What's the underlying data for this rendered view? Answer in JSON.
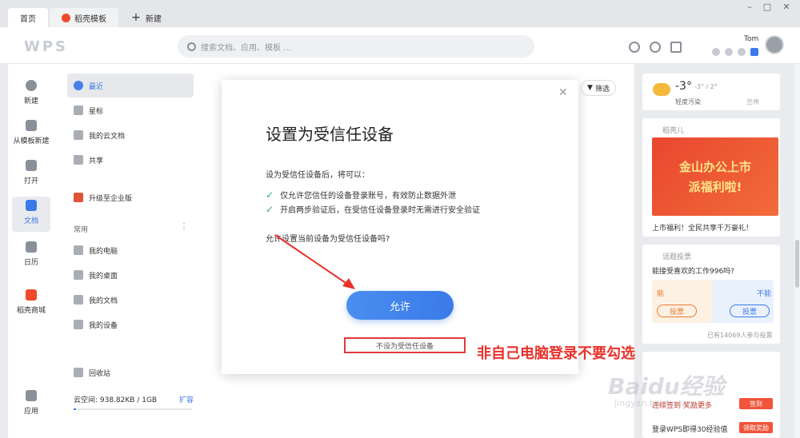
{
  "tabs": {
    "home": "首页",
    "template": "稻壳模板",
    "new": "新建"
  },
  "toolbar": {
    "logo": "WPS",
    "search_placeholder": "搜索文档、应用、模板 ...",
    "user": "Tom"
  },
  "leftnav": {
    "items": [
      {
        "label": "新建",
        "icon": "plus-circle-icon"
      },
      {
        "label": "从模板新建",
        "icon": "template-icon"
      },
      {
        "label": "打开",
        "icon": "folder-icon"
      },
      {
        "label": "文档",
        "icon": "document-icon"
      },
      {
        "label": "日历",
        "icon": "calendar-icon"
      },
      {
        "label": "稻壳商城",
        "icon": "shop-icon"
      },
      {
        "label": "应用",
        "icon": "apps-icon"
      }
    ]
  },
  "sidebar": {
    "items": [
      {
        "label": "最近",
        "icon": "clock-icon"
      },
      {
        "label": "星标",
        "icon": "star-icon"
      },
      {
        "label": "我的云文档",
        "icon": "cloud-icon"
      },
      {
        "label": "共享",
        "icon": "share-icon"
      },
      {
        "label": "升级至企业版",
        "icon": "enterprise-icon"
      }
    ],
    "common_title": "常用",
    "common": [
      {
        "label": "我的电脑"
      },
      {
        "label": "我的桌面"
      },
      {
        "label": "我的文档"
      },
      {
        "label": "我的设备"
      }
    ],
    "recycle": "回收站",
    "storage": "云空间: 938.82KB / 1GB",
    "expand": "扩容"
  },
  "main": {
    "filter": "筛选"
  },
  "dialog": {
    "title": "设置为受信任设备",
    "intro": "设为受信任设备后，将可以：",
    "line1": "仅允许您信任的设备登录账号，有效防止数据外泄",
    "line2": "开启两步验证后，在受信任设备登录时无需进行安全验证",
    "question": "允许设置当前设备为受信任设备吗?",
    "allow": "允许",
    "deny": "不设为受信任设备",
    "annotation": "非自己电脑登录不要勾选"
  },
  "right": {
    "weather": {
      "temp": "-3°",
      "range": "-3° / 2°",
      "quality": "轻度污染",
      "city": "兰州"
    },
    "ad": {
      "source": "稻壳儿",
      "banner1": "金山办公上市",
      "banner2": "派福利啦!",
      "caption": "上市福利！全民共享千万豪礼！"
    },
    "vote": {
      "head": "话题投票",
      "question": "能接受喜欢的工作996吗?",
      "yes": "能",
      "no": "不能",
      "vote": "投票",
      "count": "已有14069人参与投票"
    },
    "task": {
      "line1": "连续签到 奖励更多",
      "btn1": "签到",
      "line2": "登录WPS即得30经验值",
      "btn2": "领取奖励"
    }
  },
  "watermark": {
    "main": "Baidu经验",
    "sub": "jingyan.baidu.com"
  },
  "colors": {
    "accent": "#3a7ae8",
    "annotation": "#e8312a",
    "check": "#2db36b"
  }
}
